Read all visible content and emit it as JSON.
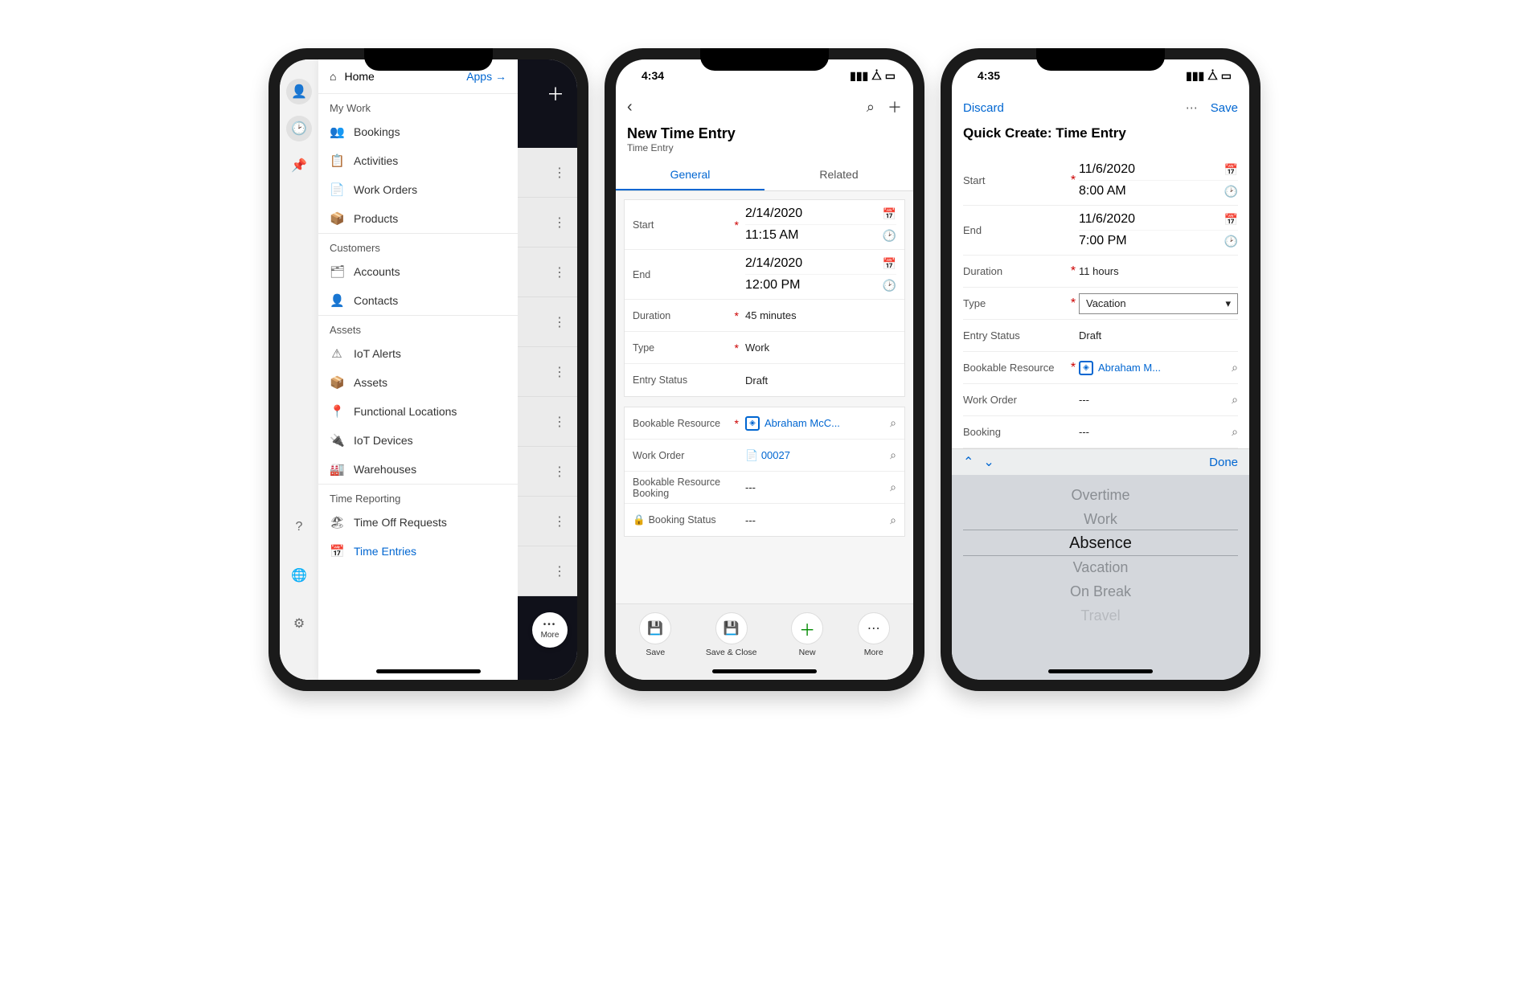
{
  "phone1": {
    "nav_header": {
      "home": "Home",
      "apps": "Apps →"
    },
    "sections": [
      {
        "title": "My Work",
        "items": [
          {
            "icon": "👥",
            "label": "Bookings"
          },
          {
            "icon": "📋",
            "label": "Activities"
          },
          {
            "icon": "📄",
            "label": "Work Orders"
          },
          {
            "icon": "📦",
            "label": "Products"
          }
        ]
      },
      {
        "title": "Customers",
        "items": [
          {
            "icon": "🗂",
            "label": "Accounts"
          },
          {
            "icon": "👤",
            "label": "Contacts"
          }
        ]
      },
      {
        "title": "Assets",
        "items": [
          {
            "icon": "⚠",
            "label": "IoT Alerts"
          },
          {
            "icon": "📦",
            "label": "Assets"
          },
          {
            "icon": "📍",
            "label": "Functional Locations"
          },
          {
            "icon": "🔌",
            "label": "IoT Devices"
          },
          {
            "icon": "🏭",
            "label": "Warehouses"
          }
        ]
      },
      {
        "title": "Time Reporting",
        "items": [
          {
            "icon": "🏖",
            "label": "Time Off Requests"
          },
          {
            "icon": "📅",
            "label": "Time Entries",
            "active": true
          }
        ]
      }
    ],
    "backdrop": {
      "more": "More"
    }
  },
  "phone2": {
    "status_time": "4:34",
    "title": "New Time Entry",
    "subtitle": "Time Entry",
    "tabs": {
      "general": "General",
      "related": "Related"
    },
    "fields": {
      "start": {
        "label": "Start",
        "date": "2/14/2020",
        "time": "11:15 AM"
      },
      "end": {
        "label": "End",
        "date": "2/14/2020",
        "time": "12:00 PM"
      },
      "duration": {
        "label": "Duration",
        "value": "45 minutes"
      },
      "type": {
        "label": "Type",
        "value": "Work"
      },
      "entry_status": {
        "label": "Entry Status",
        "value": "Draft"
      },
      "bookable_resource": {
        "label": "Bookable Resource",
        "value": "Abraham McC..."
      },
      "work_order": {
        "label": "Work Order",
        "value": "00027"
      },
      "brb": {
        "label": "Bookable Resource Booking",
        "value": "---"
      },
      "booking_status": {
        "label": "Booking Status",
        "value": "---"
      }
    },
    "footer": {
      "save": "Save",
      "save_close": "Save & Close",
      "new": "New",
      "more": "More"
    }
  },
  "phone3": {
    "status_time": "4:35",
    "toolbar": {
      "discard": "Discard",
      "save": "Save"
    },
    "title": "Quick Create: Time Entry",
    "fields": {
      "start": {
        "label": "Start",
        "date": "11/6/2020",
        "time": "8:00 AM"
      },
      "end": {
        "label": "End",
        "date": "11/6/2020",
        "time": "7:00 PM"
      },
      "duration": {
        "label": "Duration",
        "value": "11 hours"
      },
      "type": {
        "label": "Type",
        "value": "Vacation"
      },
      "entry_status": {
        "label": "Entry Status",
        "value": "Draft"
      },
      "bookable_resource": {
        "label": "Bookable Resource",
        "value": "Abraham M..."
      },
      "work_order": {
        "label": "Work Order",
        "value": "---"
      },
      "booking": {
        "label": "Booking",
        "value": "---"
      }
    },
    "acc_bar": {
      "done": "Done"
    },
    "picker": [
      "Overtime",
      "Work",
      "Absence",
      "Vacation",
      "On Break",
      "Travel"
    ],
    "picker_selected": "Absence"
  }
}
